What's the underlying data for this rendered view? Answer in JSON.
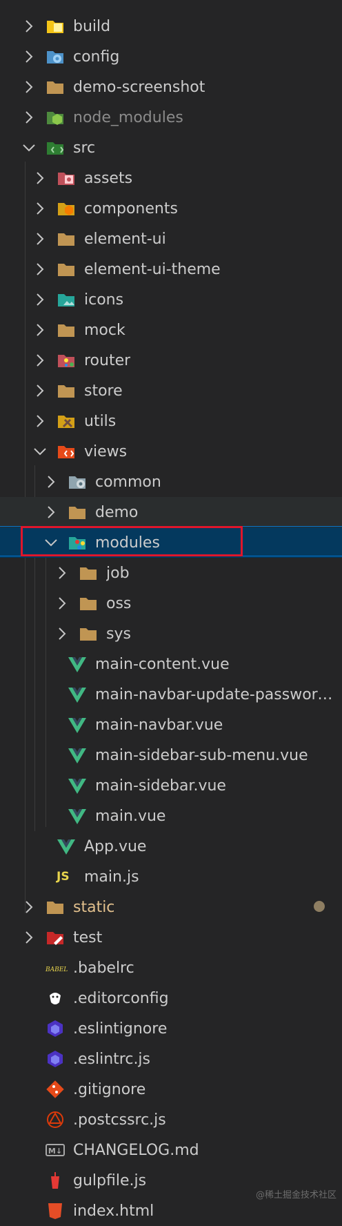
{
  "tree": [
    {
      "label": "build",
      "state": "collapsed",
      "icon": "folder-build-icon"
    },
    {
      "label": "config",
      "state": "collapsed",
      "icon": "folder-config-icon"
    },
    {
      "label": "demo-screenshot",
      "state": "collapsed",
      "icon": "folder-icon"
    },
    {
      "label": "node_modules",
      "state": "collapsed",
      "icon": "folder-node-icon",
      "dimmed": true
    },
    {
      "label": "src",
      "state": "expanded",
      "icon": "folder-src-icon"
    },
    {
      "label": "assets",
      "state": "collapsed",
      "icon": "folder-assets-icon"
    },
    {
      "label": "components",
      "state": "collapsed",
      "icon": "folder-components-icon"
    },
    {
      "label": "element-ui",
      "state": "collapsed",
      "icon": "folder-icon"
    },
    {
      "label": "element-ui-theme",
      "state": "collapsed",
      "icon": "folder-icon"
    },
    {
      "label": "icons",
      "state": "collapsed",
      "icon": "folder-images-icon"
    },
    {
      "label": "mock",
      "state": "collapsed",
      "icon": "folder-icon"
    },
    {
      "label": "router",
      "state": "collapsed",
      "icon": "folder-router-icon"
    },
    {
      "label": "store",
      "state": "collapsed",
      "icon": "folder-icon"
    },
    {
      "label": "utils",
      "state": "collapsed",
      "icon": "folder-utils-icon"
    },
    {
      "label": "views",
      "state": "expanded",
      "icon": "folder-views-icon"
    },
    {
      "label": "common",
      "state": "collapsed",
      "icon": "folder-common-icon"
    },
    {
      "label": "demo",
      "state": "collapsed",
      "icon": "folder-icon"
    },
    {
      "label": "modules",
      "state": "expanded",
      "icon": "folder-modules-icon",
      "selected": true
    },
    {
      "label": "job",
      "state": "collapsed",
      "icon": "folder-icon"
    },
    {
      "label": "oss",
      "state": "collapsed",
      "icon": "folder-icon"
    },
    {
      "label": "sys",
      "state": "collapsed",
      "icon": "folder-icon"
    },
    {
      "label": "main-content.vue",
      "state": "file",
      "icon": "vue-file-icon"
    },
    {
      "label": "main-navbar-update-password.vue",
      "state": "file",
      "icon": "vue-file-icon"
    },
    {
      "label": "main-navbar.vue",
      "state": "file",
      "icon": "vue-file-icon"
    },
    {
      "label": "main-sidebar-sub-menu.vue",
      "state": "file",
      "icon": "vue-file-icon"
    },
    {
      "label": "main-sidebar.vue",
      "state": "file",
      "icon": "vue-file-icon"
    },
    {
      "label": "main.vue",
      "state": "file",
      "icon": "vue-file-icon"
    },
    {
      "label": "App.vue",
      "state": "file",
      "icon": "vue-file-icon"
    },
    {
      "label": "main.js",
      "state": "file",
      "icon": "js-file-icon",
      "icon_text": "JS"
    },
    {
      "label": "static",
      "state": "collapsed",
      "icon": "folder-icon",
      "modified": true
    },
    {
      "label": "test",
      "state": "collapsed",
      "icon": "folder-test-icon"
    },
    {
      "label": ".babelrc",
      "state": "file",
      "icon": "babel-file-icon",
      "icon_text": "BABEL"
    },
    {
      "label": ".editorconfig",
      "state": "file",
      "icon": "editorconfig-file-icon"
    },
    {
      "label": ".eslintignore",
      "state": "file",
      "icon": "eslint-file-icon"
    },
    {
      "label": ".eslintrc.js",
      "state": "file",
      "icon": "eslint-file-icon"
    },
    {
      "label": ".gitignore",
      "state": "file",
      "icon": "git-file-icon"
    },
    {
      "label": ".postcssrc.js",
      "state": "file",
      "icon": "postcss-file-icon"
    },
    {
      "label": "CHANGELOG.md",
      "state": "file",
      "icon": "markdown-file-icon",
      "icon_text": "M↓"
    },
    {
      "label": "gulpfile.js",
      "state": "file",
      "icon": "gulp-file-icon"
    },
    {
      "label": "index.html",
      "state": "file",
      "icon": "html-file-icon"
    }
  ],
  "watermark": "@稀土掘金技术社区",
  "colors": {
    "background": "#252526",
    "text": "#cccccc",
    "selected_row": "#04395e",
    "highlight_box": "#e0162b",
    "vue_green": "#41b883",
    "folder": "#c09553",
    "modified_text": "#e2c08d"
  }
}
